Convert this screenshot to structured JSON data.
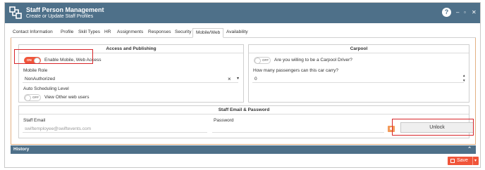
{
  "window": {
    "title": "Staff Person Management",
    "subtitle": "Create or Update Staff Profiles",
    "help_glyph": "?",
    "minimize": "–",
    "maximize": "▫",
    "close": "✕"
  },
  "tabs": [
    {
      "label": "Contact Information",
      "active": false
    },
    {
      "label": "Profile",
      "active": false
    },
    {
      "label": "Skill Types",
      "active": false
    },
    {
      "label": "HR",
      "active": false
    },
    {
      "label": "Assignments",
      "active": false
    },
    {
      "label": "Responses",
      "active": false
    },
    {
      "label": "Security",
      "active": false
    },
    {
      "label": "Mobile/Web",
      "active": true
    },
    {
      "label": "Availability",
      "active": false
    }
  ],
  "access": {
    "heading": "Access and Publishing",
    "mobile_toggle_state": "ON",
    "mobile_toggle_label": "Enable Mobile, Web Access",
    "mobile_role_label": "Mobile Role",
    "mobile_role_value": "NonAuthorized",
    "clear_glyph": "×",
    "dropdown_glyph": "▾",
    "auto_sched_label": "Auto Scheduling Level",
    "view_toggle_state": "OFF",
    "view_toggle_label": "View Other web users"
  },
  "carpool": {
    "heading": "Carpool",
    "toggle_state": "OFF",
    "question": "Are you willing to be a Carpool Driver?",
    "passengers_label": "How many passengers can this car carry?",
    "passengers_value": "0",
    "spin_up": "▲",
    "spin_down": "▼"
  },
  "email_password": {
    "heading": "Staff Email & Password",
    "email_label": "Staff Email",
    "email_placeholder": "swiftemployee@swiftevents.com",
    "password_label": "Password",
    "unlock_label": "Unlock"
  },
  "history": {
    "label": "History",
    "chevron": "⌃"
  },
  "save": {
    "label": "Save",
    "caret": "▾"
  },
  "colors": {
    "header": "#4e7089",
    "accent": "#f0553a",
    "highlight_box": "#d8262a"
  }
}
